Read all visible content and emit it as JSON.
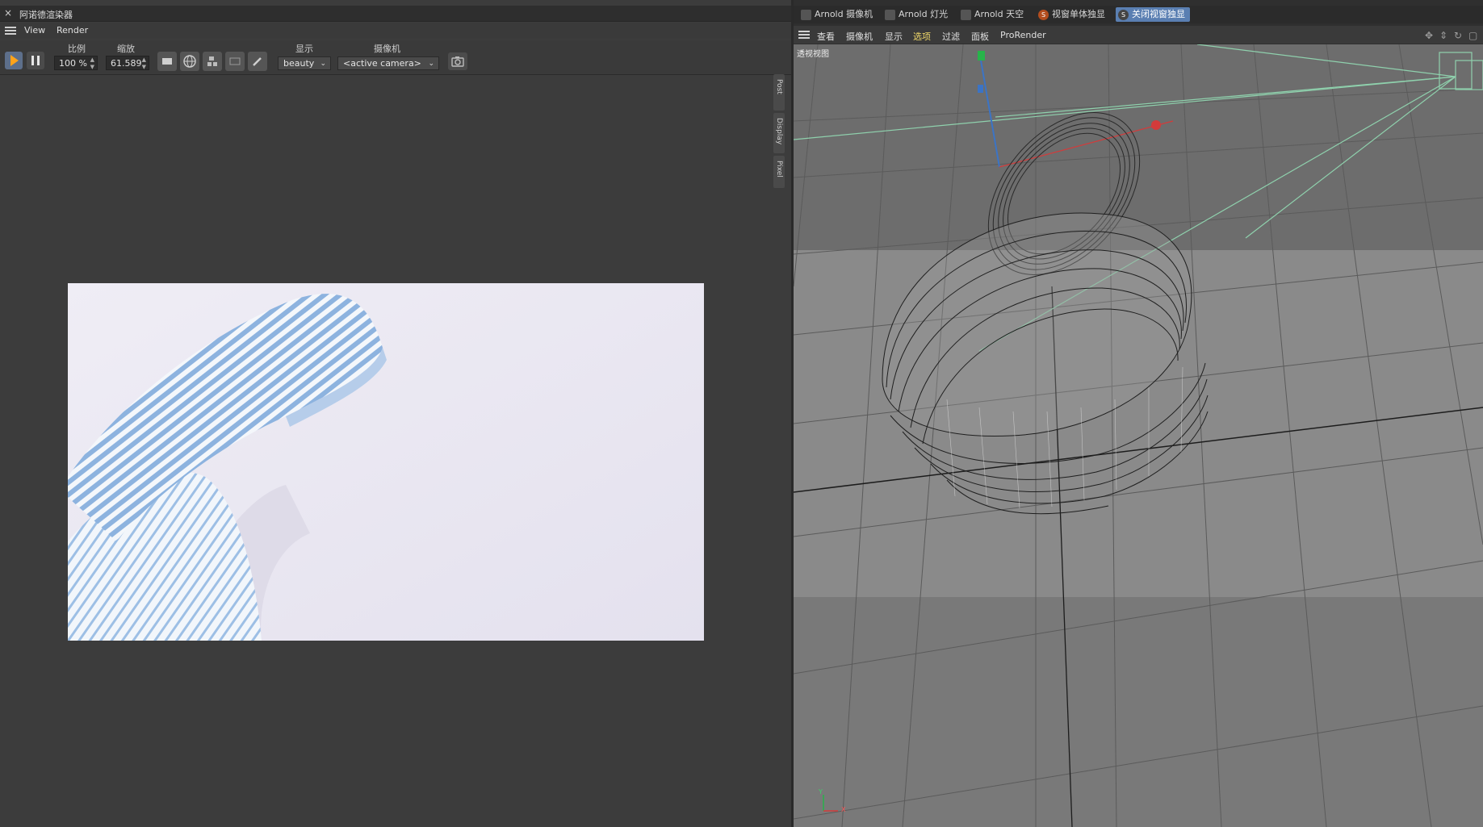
{
  "render_window": {
    "title": "阿诺德渲染器",
    "close_glyph": "×",
    "menu": [
      "View",
      "Render"
    ],
    "toolbar": {
      "ratio_label": "比例",
      "ratio_value": "100 %",
      "zoom_label": "缩放",
      "zoom_value": "61.589",
      "display_label": "显示",
      "display_value": "beauty",
      "camera_label": "摄像机",
      "camera_value": "<active camera>"
    },
    "side_tabs": [
      "Post",
      "Display",
      "Pixel"
    ]
  },
  "viewport_panel": {
    "tabs": [
      "Arnold 摄像机",
      "Arnold 灯光",
      "Arnold 天空",
      "视窗单体独显",
      "关闭视窗独显"
    ],
    "tab_badge": "S",
    "menu": [
      "查看",
      "摄像机",
      "显示",
      "选项",
      "过滤",
      "面板",
      "ProRender"
    ],
    "viewport_label": "透视视图",
    "axis_labels": {
      "y": "Y",
      "x": "X"
    }
  },
  "colors": {
    "accent_active_tab": "#5a7fb2",
    "play_icon": "#ffa31a",
    "render_bg": "#ece9f4",
    "ribbon_blue": "#8fb4e0",
    "highlight_menu": "#f0d86a"
  },
  "icons": [
    "close-icon",
    "hamburger-icon",
    "play-icon",
    "pause-icon",
    "camera-snapshot-icon",
    "arnold-camera-icon",
    "arnold-light-icon",
    "arnold-sky-icon",
    "move-icon",
    "rotate-icon",
    "maximize-icon"
  ]
}
